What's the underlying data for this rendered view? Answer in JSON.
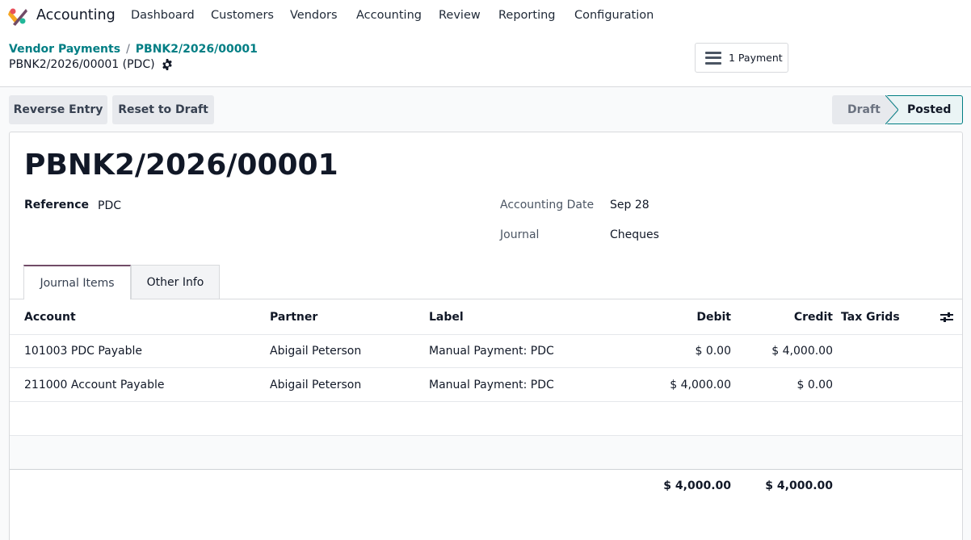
{
  "app": {
    "name": "Accounting"
  },
  "menu": [
    "Dashboard",
    "Customers",
    "Vendors",
    "Accounting",
    "Review",
    "Reporting",
    "Configuration"
  ],
  "breadcrumb": {
    "parent": "Vendor Payments",
    "current": "PBNK2/2026/00001",
    "separator": "/"
  },
  "record_line": "PBNK2/2026/00001 (PDC)",
  "smart_button": {
    "label": "1 Payment",
    "icon": "list-icon"
  },
  "actions": {
    "reverse": "Reverse Entry",
    "reset": "Reset to Draft"
  },
  "status": {
    "stages": [
      "Draft",
      "Posted"
    ],
    "current": "Posted",
    "accent": "#017e84"
  },
  "form": {
    "title": "PBNK2/2026/00001",
    "reference_label": "Reference",
    "reference_value": "PDC",
    "date_label": "Accounting Date",
    "date_value": "Sep 28",
    "journal_label": "Journal",
    "journal_value": "Cheques"
  },
  "tabs": [
    "Journal Items",
    "Other Info"
  ],
  "table": {
    "headers": [
      "Account",
      "Partner",
      "Label",
      "Debit",
      "Credit",
      "Tax Grids"
    ],
    "rows": [
      [
        "101003 PDC Payable",
        "Abigail Peterson",
        "Manual Payment: PDC",
        "$ 0.00",
        "$ 4,000.00",
        ""
      ],
      [
        "211000 Account Payable",
        "Abigail Peterson",
        "Manual Payment: PDC",
        "$ 4,000.00",
        "$ 0.00",
        ""
      ]
    ],
    "totals": {
      "debit": "$ 4,000.00",
      "credit": "$ 4,000.00"
    }
  },
  "colors": {
    "brand": "#714b67",
    "link": "#017e84"
  }
}
